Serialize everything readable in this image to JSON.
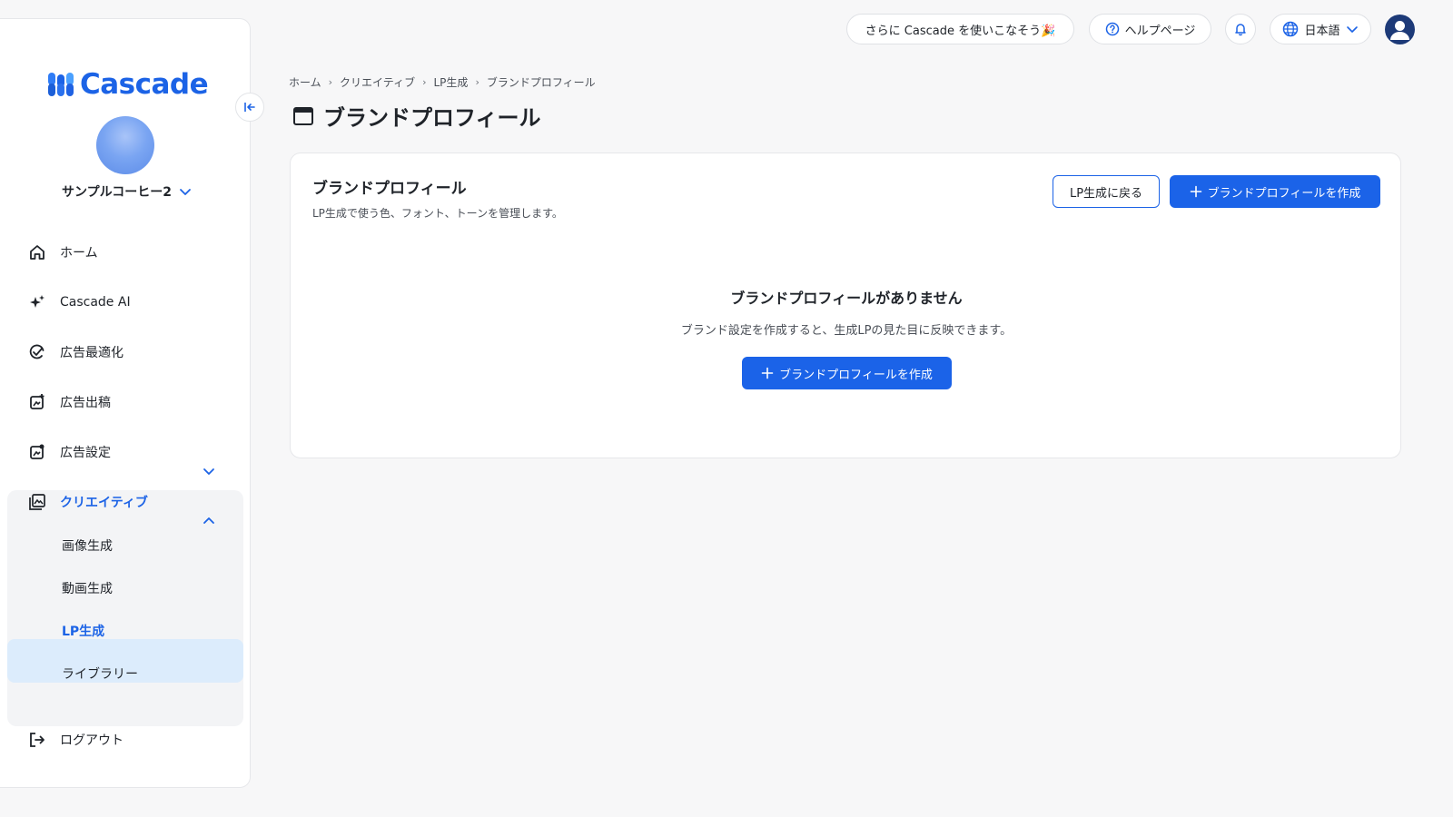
{
  "brand": {
    "name": "Cascade"
  },
  "workspace": {
    "name": "サンプルコーヒー2"
  },
  "nav": {
    "home": "ホーム",
    "cascade_ai": "Cascade AI",
    "ad_optimize": "広告最適化",
    "ad_publish": "広告出稿",
    "ad_settings": "広告設定",
    "creative": "クリエイティブ",
    "creative_sub": [
      "画像生成",
      "動画生成",
      "LP生成",
      "ライブラリー"
    ],
    "logout": "ログアウト"
  },
  "topbar": {
    "promo": "さらに Cascade を使いこなそう🎉",
    "help": "ヘルプページ",
    "language": "日本語"
  },
  "breadcrumb": [
    "ホーム",
    "クリエイティブ",
    "LP生成",
    "ブランドプロフィール"
  ],
  "page": {
    "title": "ブランドプロフィール"
  },
  "card": {
    "title": "ブランドプロフィール",
    "subtitle": "LP生成で使う色、フォント、トーンを管理します。",
    "back_button": "LP生成に戻る",
    "create_button": "ブランドプロフィールを作成",
    "empty_title": "ブランドプロフィールがありません",
    "empty_desc": "ブランド設定を作成すると、生成LPの見た目に反映できます。",
    "empty_create_button": "ブランドプロフィールを作成"
  },
  "colors": {
    "primary": "#1b63e8",
    "active_bg": "#dcecfc",
    "active_text": "#1c63e6"
  }
}
